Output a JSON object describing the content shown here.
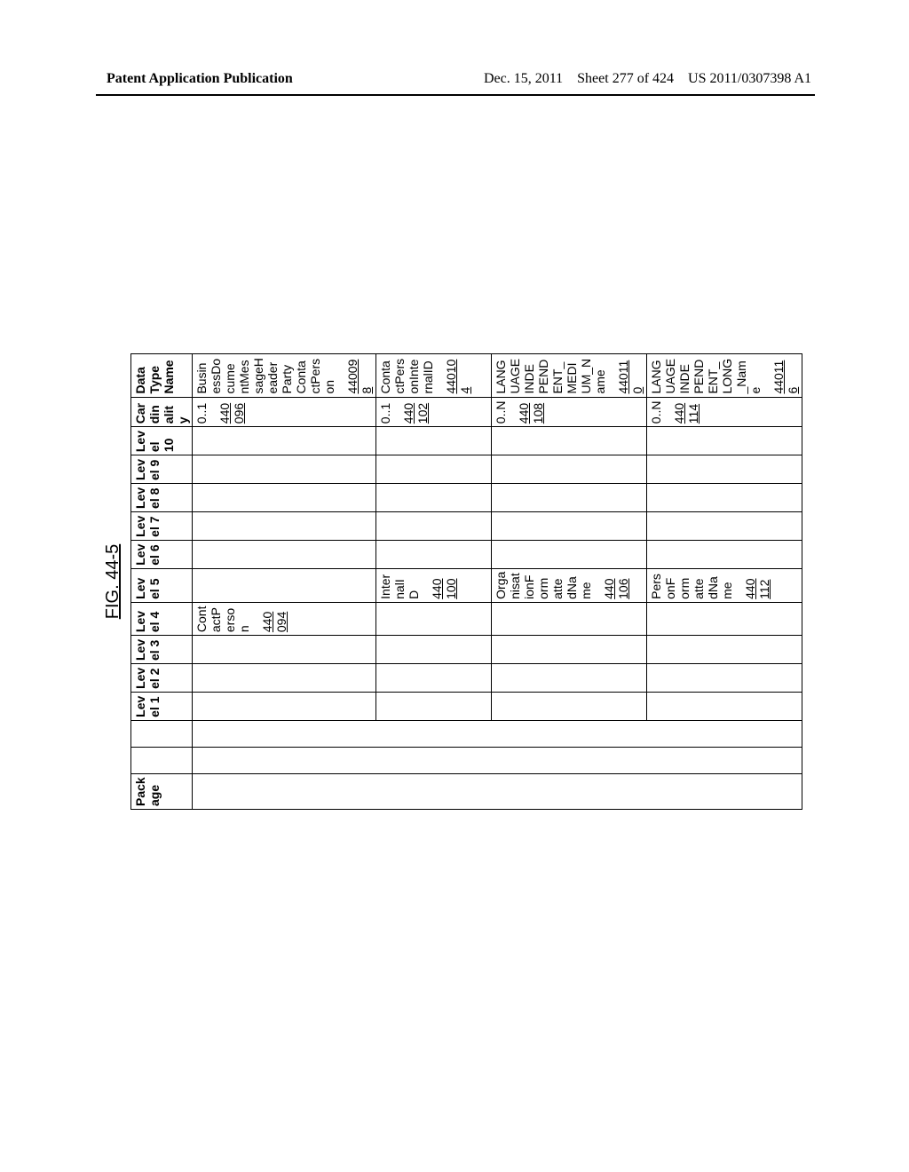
{
  "header": {
    "left": "Patent Application Publication",
    "date": "Dec. 15, 2011",
    "sheet": "Sheet 277 of 424",
    "pubno": "US 2011/0307398 A1"
  },
  "figure_title": "FIG. 44-5",
  "columns": [
    "Package",
    "",
    "",
    "Level 1",
    "Level 2",
    "Level 3",
    "Level 4",
    "Level 5",
    "Level 6",
    "Level 7",
    "Level 8",
    "Level 9",
    "Level 10",
    "Cardinality",
    "Data Type Name"
  ],
  "rows": [
    {
      "level4": "ContactPerson",
      "level4_ref": "440094",
      "level5": "",
      "level5_ref": "",
      "cardinality": "0..1",
      "card_ref": "440096",
      "datatype": "BusinessDocumentMessageHeaderPartyContactPerson",
      "dt_ref": "440098"
    },
    {
      "level4": "",
      "level4_ref": "",
      "level5": "InternalID",
      "level5_ref": "440100",
      "cardinality": "0..1",
      "card_ref": "440102",
      "datatype": "ContactPersonInternalID",
      "dt_ref": "440104"
    },
    {
      "level4": "",
      "level4_ref": "",
      "level5": "OrganisationFormattedName",
      "level5_ref": "440106",
      "cardinality": "0..N",
      "card_ref": "440108",
      "datatype": "LANGUAGEINDEPENDENT_MEDIUM_Name",
      "dt_ref": "440110"
    },
    {
      "level4": "",
      "level4_ref": "",
      "level5": "PersonFormattedName",
      "level5_ref": "440112",
      "cardinality": "0..N",
      "card_ref": "440114",
      "datatype": "LANGUAGEINDEPENDENT_LONG_Name",
      "dt_ref": "440116"
    }
  ]
}
